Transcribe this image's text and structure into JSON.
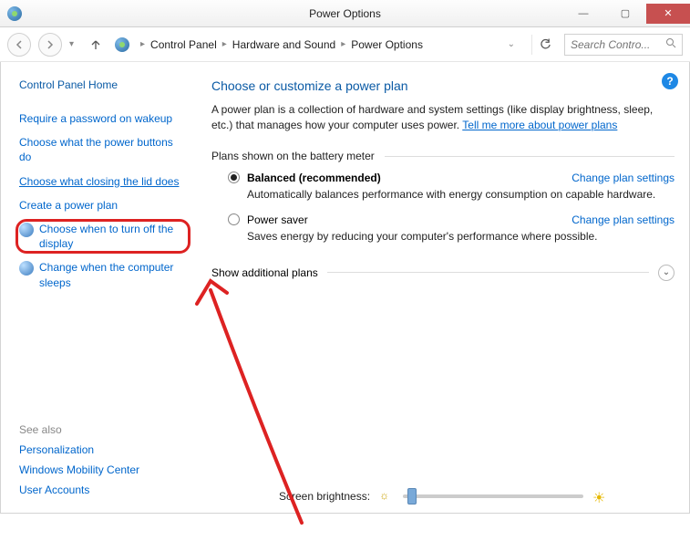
{
  "window": {
    "title": "Power Options"
  },
  "breadcrumb": {
    "items": [
      "Control Panel",
      "Hardware and Sound",
      "Power Options"
    ]
  },
  "search": {
    "placeholder": "Search Contro..."
  },
  "sidebar": {
    "home": "Control Panel Home",
    "links": [
      "Require a password on wakeup",
      "Choose what the power buttons do",
      "Choose what closing the lid does",
      "Create a power plan",
      "Choose when to turn off the display",
      "Change when the computer sleeps"
    ],
    "seealso_header": "See also",
    "seealso": [
      "Personalization",
      "Windows Mobility Center",
      "User Accounts"
    ]
  },
  "main": {
    "heading": "Choose or customize a power plan",
    "description": "A power plan is a collection of hardware and system settings (like display brightness, sleep, etc.) that manages how your computer uses power. ",
    "desc_link": "Tell me more about power plans",
    "section_label": "Plans shown on the battery meter",
    "plans": [
      {
        "name": "Balanced (recommended)",
        "desc": "Automatically balances performance with energy consumption on capable hardware.",
        "change": "Change plan settings",
        "selected": true
      },
      {
        "name": "Power saver",
        "desc": "Saves energy by reducing your computer's performance where possible.",
        "change": "Change plan settings",
        "selected": false
      }
    ],
    "additional_label": "Show additional plans",
    "brightness_label": "Screen brightness:"
  }
}
